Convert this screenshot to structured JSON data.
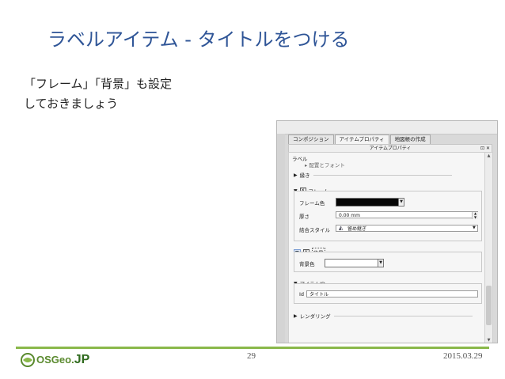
{
  "slide": {
    "title": "ラベルアイテム - タイトルをつける",
    "body_lines": [
      "「フレーム」「背景」も設定",
      "しておきましょう"
    ]
  },
  "panel": {
    "tabs": [
      "コンポジション",
      "アイテムプロパティ",
      "地図帳の作成"
    ],
    "header_title": "アイテムプロパティ",
    "header_controls": "⊡ ✕",
    "section_label": "ラベル",
    "truncated_group": "▸ 配置とフォント",
    "groups": {
      "position": "縁き",
      "frame": "フレーム",
      "background": "背景",
      "item_id": "アイテムID",
      "rendering": "レンダリング"
    },
    "frame": {
      "color_label": "フレーム色",
      "color_value": "#000000",
      "thickness_label": "厚さ",
      "thickness_value": "0.00 mm",
      "join_label": "結合スタイル",
      "join_value": "留め継ぎ"
    },
    "background": {
      "color_label": "背景色",
      "color_value": "#ffffff"
    },
    "item_id": {
      "id_label": "Id",
      "id_value": "タイトル"
    }
  },
  "footer": {
    "logo_text": "OSGeo.",
    "logo_jp": "JP",
    "page_number": "29",
    "date": "2015.03.29"
  },
  "colors": {
    "title": "#2f5597",
    "footer_line": "#8ab84a",
    "logo_green": "#5a8a2e"
  }
}
